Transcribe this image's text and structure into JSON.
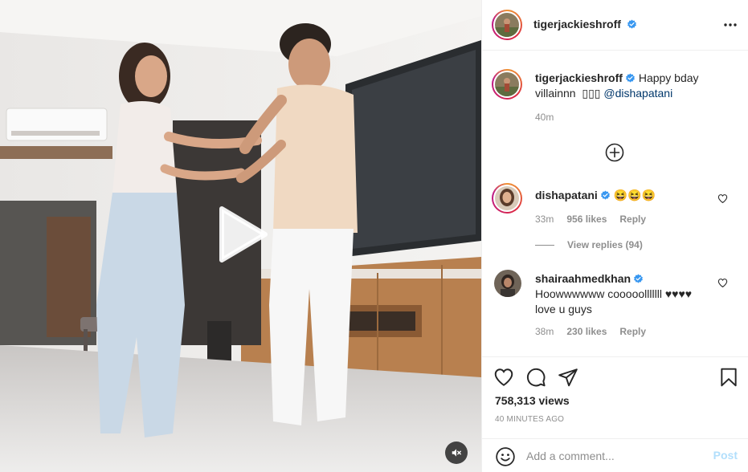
{
  "post": {
    "author": "tigerjackieshroff",
    "verified": true,
    "more_icon": "more-horizontal-icon"
  },
  "caption": {
    "username": "tigerjackieshroff",
    "text_before": "Happy bday villainnn  ▯▯▯ ",
    "mention": "@dishapatani",
    "time": "40m"
  },
  "load_more_icon": "plus-circle-icon",
  "comments": [
    {
      "username": "dishapatani",
      "verified": true,
      "text": "😆😆😆",
      "time": "33m",
      "likes": "956 likes",
      "reply_label": "Reply",
      "view_replies": "View replies (94)"
    },
    {
      "username": "shairaahmedkhan",
      "verified": true,
      "text": "Hoowwwwww cooooolllllll ♥♥♥♥ love u guys",
      "time": "38m",
      "likes": "230 likes",
      "reply_label": "Reply"
    }
  ],
  "stats": {
    "views": "758,313 views",
    "posted": "40 MINUTES AGO"
  },
  "composer": {
    "placeholder": "Add a comment...",
    "post_label": "Post"
  },
  "colors": {
    "link": "#00376b",
    "muted": "#8e8e8e",
    "post_button_disabled": "#b2dffc",
    "verified_badge": "#3897f0"
  }
}
